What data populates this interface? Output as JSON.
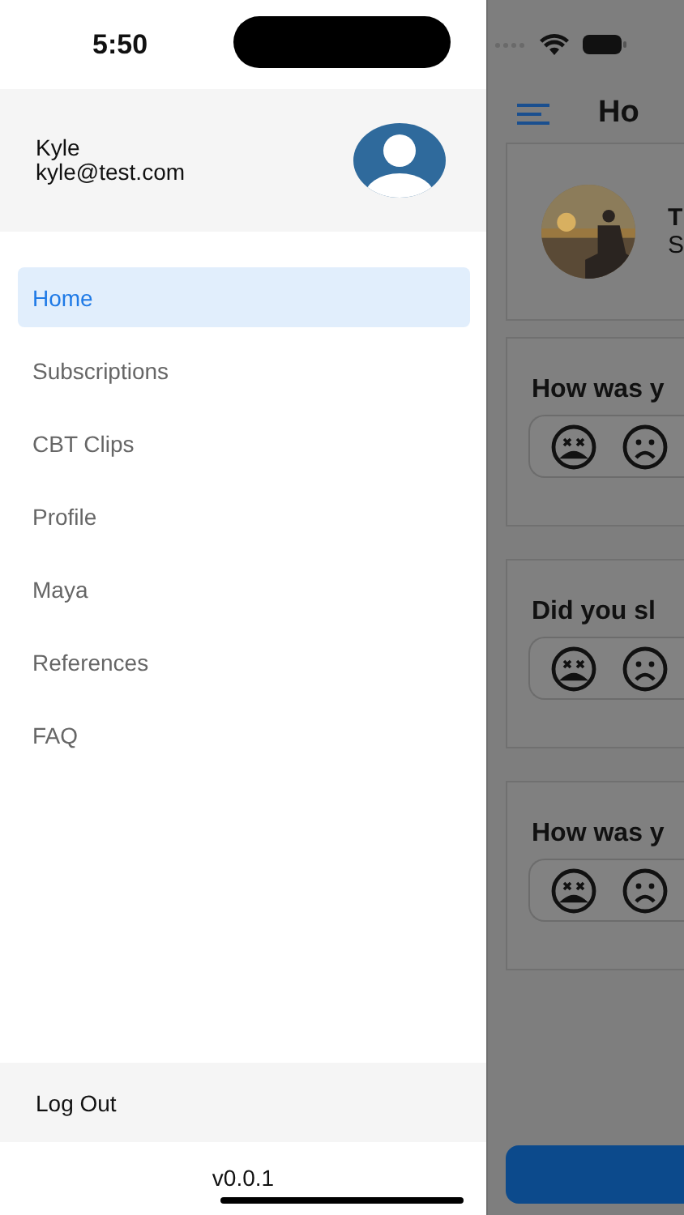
{
  "status_bar": {
    "time": "5:50"
  },
  "drawer": {
    "user": {
      "name": "Kyle",
      "email": "kyle@test.com"
    },
    "menu": [
      {
        "label": "Home",
        "selected": true
      },
      {
        "label": "Subscriptions",
        "selected": false
      },
      {
        "label": "CBT Clips",
        "selected": false
      },
      {
        "label": "Profile",
        "selected": false
      },
      {
        "label": "Maya",
        "selected": false
      },
      {
        "label": "References",
        "selected": false
      },
      {
        "label": "FAQ",
        "selected": false
      }
    ],
    "logout": "Log Out",
    "version": "v0.0.1"
  },
  "background_screen": {
    "title": "Ho",
    "featured": {
      "title": "T",
      "subtitle": "S"
    },
    "questions": [
      {
        "text": "How was y"
      },
      {
        "text": "Did you sl"
      },
      {
        "text": "How was y"
      }
    ]
  }
}
